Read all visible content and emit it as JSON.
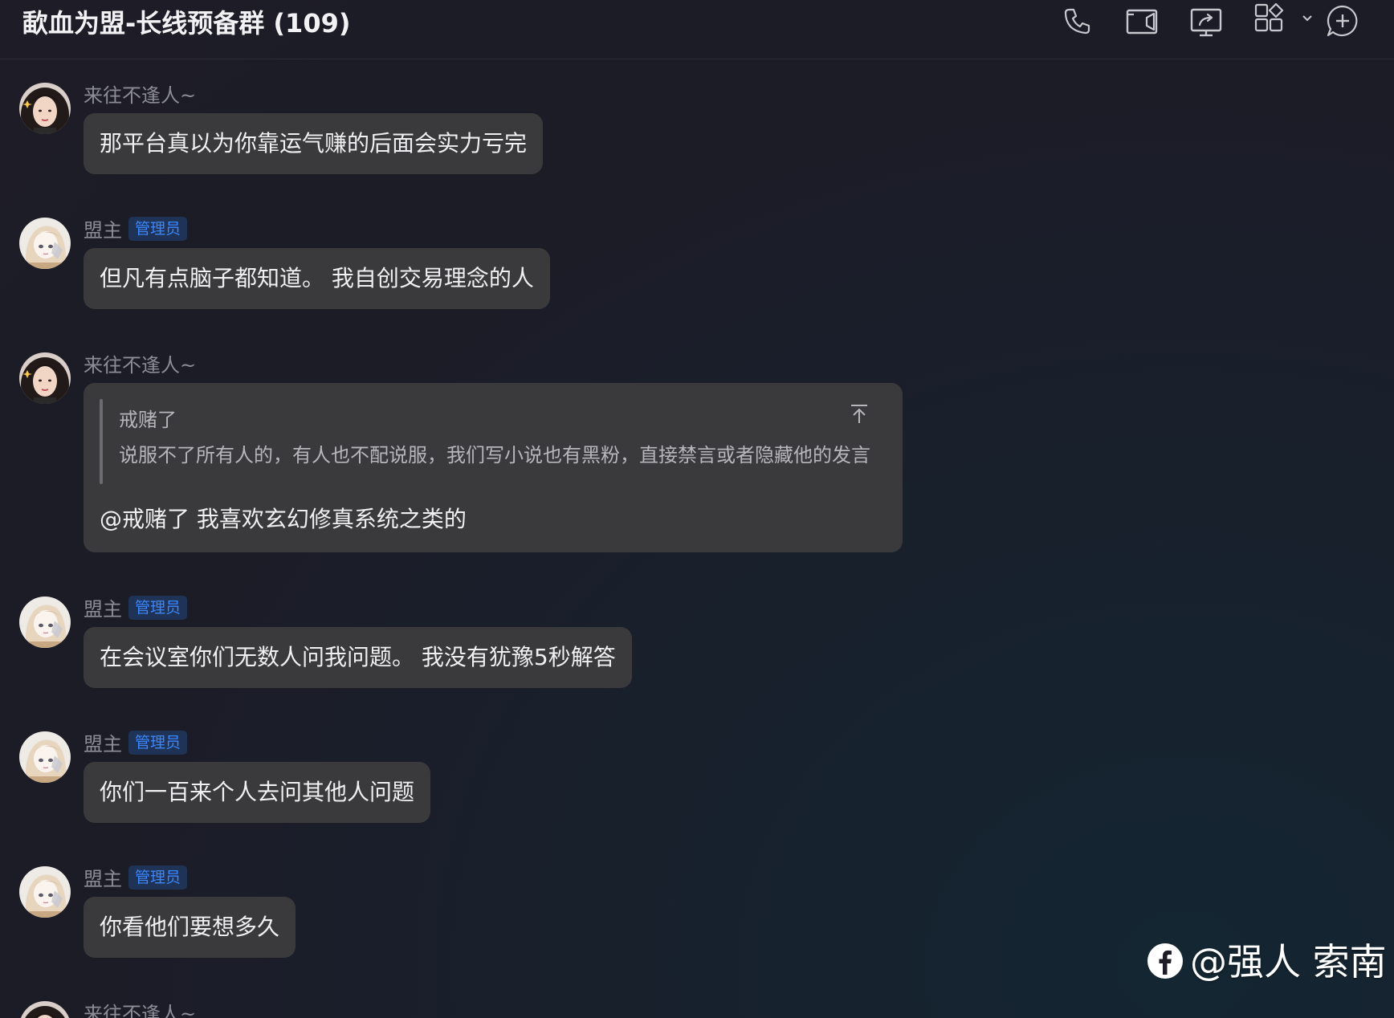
{
  "header": {
    "title": "歃血为盟-长线预备群 (109)",
    "icons": [
      "phone-icon",
      "video-icon",
      "screen-share-icon",
      "apps-grid-icon",
      "chevron-down-icon",
      "add-chat-icon"
    ]
  },
  "messages": [
    {
      "sender": "来往不逢人~",
      "text": "那平台真以为你靠运气赚的后面会实力亏完"
    },
    {
      "sender": "盟主",
      "badge": "管理员",
      "text": "但凡有点脑子都知道。 我自创交易理念的人"
    },
    {
      "sender": "来往不逢人~",
      "quote": {
        "author": "戒赌了",
        "text": "说服不了所有人的，有人也不配说服，我们写小说也有黑粉，直接禁言或者隐藏他的发言"
      },
      "text": "@戒赌了 我喜欢玄幻修真系统之类的"
    },
    {
      "sender": "盟主",
      "badge": "管理员",
      "text": "在会议室你们无数人问我问题。 我没有犹豫5秒解答"
    },
    {
      "sender": "盟主",
      "badge": "管理员",
      "text": "你们一百来个人去问其他人问题"
    },
    {
      "sender": "盟主",
      "badge": "管理员",
      "text": "你看他们要想多久"
    },
    {
      "sender": "来往不逢人~"
    }
  ],
  "watermark": {
    "icon": "facebook-icon",
    "text": "@强人 索南"
  },
  "colors": {
    "background": "#1d1c27",
    "bubble": "#3a3a3d",
    "badge_text": "#3d87ff",
    "badge_bg": "#1e3356"
  }
}
